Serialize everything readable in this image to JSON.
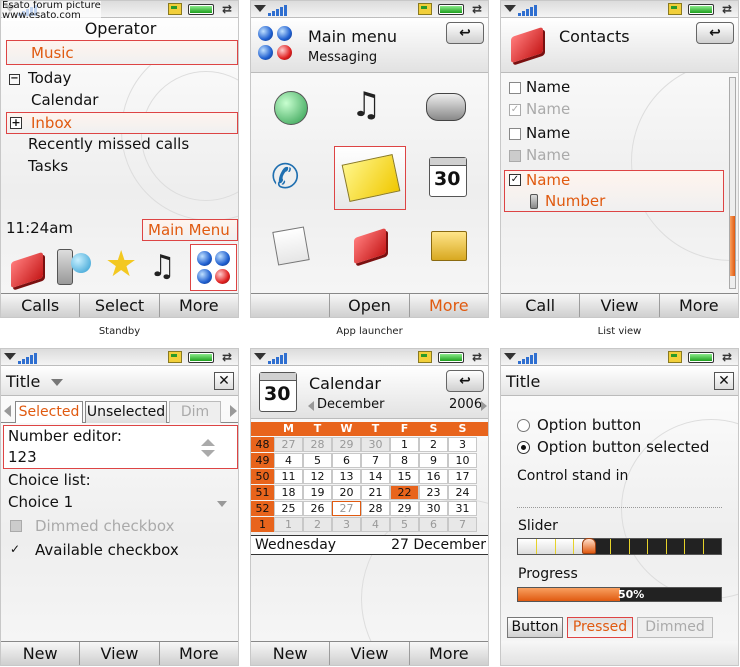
{
  "watermark": {
    "line1": "Esato forum picture",
    "line2": "www.esato.com"
  },
  "standby": {
    "operator": "Operator",
    "items": [
      "Music",
      "Today",
      "Calendar",
      "Inbox",
      "Recently missed calls",
      "Tasks"
    ],
    "time": "11:24am",
    "main_menu_label": "Main Menu",
    "softkeys": [
      "Calls",
      "Select",
      "More"
    ],
    "caption": "Standby"
  },
  "launcher": {
    "title": "Main menu",
    "subtitle": "Messaging",
    "back_label": "↩",
    "calendar_day": "30",
    "softkeys": [
      "Open",
      "More"
    ],
    "caption": "App launcher"
  },
  "listview": {
    "title": "Contacts",
    "back_label": "↩",
    "rows": [
      "Name",
      "Name",
      "Name",
      "Name",
      "Name"
    ],
    "selected_number": "Number",
    "softkeys": [
      "Call",
      "View",
      "More"
    ],
    "caption": "List view"
  },
  "form": {
    "title": "Title",
    "close_label": "✕",
    "tabs": [
      "Selected",
      "Unselected",
      "Dim"
    ],
    "number_label": "Number editor:",
    "number_value": "123",
    "choice_label": "Choice list:",
    "choice_value": "Choice 1",
    "dimmed_checkbox": "Dimmed checkbox",
    "available_checkbox": "Available checkbox",
    "softkeys": [
      "New",
      "View",
      "More"
    ]
  },
  "calendar": {
    "title": "Calendar",
    "icon_day": "30",
    "month": "December",
    "year": "2006",
    "back_label": "↩",
    "weekday_headers": [
      "M",
      "T",
      "W",
      "T",
      "F",
      "S",
      "S"
    ],
    "weeks": [
      {
        "wk": "48",
        "days": [
          "27",
          "28",
          "29",
          "30",
          "1",
          "2",
          "3"
        ]
      },
      {
        "wk": "49",
        "days": [
          "4",
          "5",
          "6",
          "7",
          "8",
          "9",
          "10"
        ]
      },
      {
        "wk": "50",
        "days": [
          "11",
          "12",
          "13",
          "14",
          "15",
          "16",
          "17"
        ]
      },
      {
        "wk": "51",
        "days": [
          "18",
          "19",
          "20",
          "21",
          "22",
          "23",
          "24"
        ]
      },
      {
        "wk": "52",
        "days": [
          "25",
          "26",
          "27",
          "28",
          "29",
          "30",
          "31"
        ]
      },
      {
        "wk": "1",
        "days": [
          "1",
          "2",
          "3",
          "4",
          "5",
          "6",
          "7"
        ]
      }
    ],
    "footer_day": "Wednesday",
    "footer_date": "27 December",
    "softkeys": [
      "New",
      "View",
      "More"
    ]
  },
  "controls": {
    "title": "Title",
    "close_label": "✕",
    "option1": "Option button",
    "option2": "Option button selected",
    "control_stand_in": "Control stand in",
    "slider_label": "Slider",
    "slider_value": 0.35,
    "progress_label": "Progress",
    "progress_value": "50%",
    "progress_fraction": 0.5,
    "buttons": [
      "Button",
      "Pressed",
      "Dimmed"
    ]
  },
  "colors": {
    "accent": "#e05a10",
    "selected_border": "#d44444",
    "calendar_header": "#e8641c"
  }
}
